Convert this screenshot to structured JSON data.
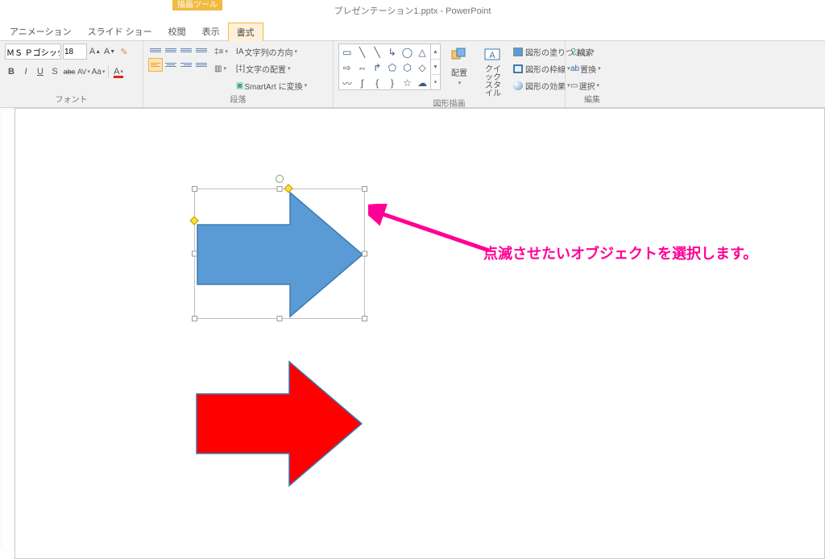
{
  "title": "プレゼンテーション1.pptx - PowerPoint",
  "tool_context": {
    "group": "描画ツール",
    "tab": "書式"
  },
  "tabs": [
    "アニメーション",
    "スライド ショー",
    "校閲",
    "表示",
    "書式"
  ],
  "font": {
    "name": "ＭＳ Ｐゴシック",
    "size": "18",
    "buttons": {
      "incA": "A",
      "decA": "A",
      "clear": "✎",
      "B": "B",
      "I": "I",
      "U": "U",
      "S": "S",
      "abc": "abc",
      "av": "AV",
      "Aa": "Aa",
      "fontColor": "A"
    }
  },
  "paragraph": {
    "textDirection": "文字列の方向",
    "textAlign": "文字の配置",
    "smartArt": "SmartArt に変換"
  },
  "drawing": {
    "arrange": "配置",
    "quickStyle": "クイック\nスタイル",
    "shapeFill": "図形の塗りつぶし",
    "shapeOutline": "図形の枠線",
    "shapeEffects": "図形の効果"
  },
  "editing": {
    "find": "検索",
    "replace": "置換",
    "select": "選択"
  },
  "group_labels": {
    "font": "フォント",
    "paragraph": "段落",
    "drawing": "図形描画",
    "editing": "編集"
  },
  "annotation": "点滅させたいオブジェクトを選択します。",
  "shapes": {
    "blue_arrow": {
      "selected": true,
      "fill": "#5B9BD5",
      "stroke": "#3C79B4"
    },
    "red_arrow": {
      "selected": false,
      "fill": "#FF0000",
      "stroke": "#3C79B4"
    }
  }
}
